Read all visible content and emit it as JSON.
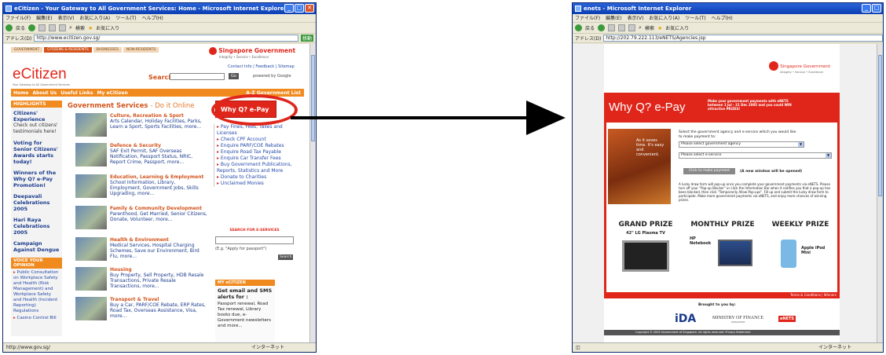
{
  "left": {
    "title": "eCitizen - Your Gateway to All Government Services: Home - Microsoft Internet Explorer",
    "menu": [
      "ファイル(F)",
      "編集(E)",
      "表示(V)",
      "お気に入り(A)",
      "ツール(T)",
      "ヘルプ(H)"
    ],
    "toolbar": [
      "戻る",
      "検索",
      "お気に入り"
    ],
    "address_label": "アドレス(D)",
    "address": "http://www.ecitizen.gov.sg/",
    "go": "移動",
    "top_tabs": [
      "GOVERNMENT",
      "CITIZENS & RESIDENTS",
      "BUSINESSES",
      "NON-RESIDENTS"
    ],
    "gov_brand": "Singapore Government",
    "gov_tag": "Integrity • Service • Excellence",
    "site_name": "eCitizen",
    "site_tag": "Your Gateway to All Government Services",
    "toplinks": "Contact Info | Feedback | Sitemap",
    "search_label": "Search",
    "search_btn": "Go",
    "powered": "powered by Google",
    "nav": [
      "Home",
      "About Us",
      "Useful Links",
      "My eCitizen"
    ],
    "nav_right": "A-Z Government List",
    "highlights_title": "HIGHLIGHTS",
    "highlights": [
      {
        "title": "Citizens' Experience",
        "body": "Check out citizens' testimonials here!"
      },
      {
        "title": "Voting for Senior Citizens' Awards starts today!",
        "body": ""
      },
      {
        "title": "Winners of the Why Q? e-Pay Promotion!",
        "body": ""
      },
      {
        "title": "Deepavali Celebrations 2005",
        "body": ""
      },
      {
        "title": "Hari Raya Celebrations 2005",
        "body": ""
      },
      {
        "title": "Campaign Against Dengue",
        "body": ""
      }
    ],
    "voice_title": "VOICE YOUR OPINION",
    "voice_items": [
      "Public Consultation on Workplace Safety and Health (Risk Management) and Workplace Safety and Health (Incident Reporting) Regulations",
      "Casino Control Bill"
    ],
    "services_title": "Government Services",
    "services_sub": "- Do it Online",
    "categories": [
      {
        "title": "Culture, Recreation & Sport",
        "body": "Arts Calendar, Holiday Facilities, Parks, Learn a Sport, Sports Facilities, more..."
      },
      {
        "title": "Defence & Security",
        "body": "SAF Exit Permit, SAF Overseas Notification, Passport Status, NRIC, Report Crime, Passport, more..."
      },
      {
        "title": "Education, Learning & Employment",
        "body": "School Information, Library, Employment, Government Jobs, Skills Upgrading, more..."
      },
      {
        "title": "Family & Community Development",
        "body": "Parenthood, Get Married, Senior Citizens, Donate, Volunteer, more..."
      },
      {
        "title": "Health & Environment",
        "body": "Medical Services, Hospital Charging Schemes, Save our Environment, Bird Flu, more..."
      },
      {
        "title": "Housing",
        "body": "Buy Property, Sell Property, HDB Resale Transactions, Private Resale Transactions, more..."
      },
      {
        "title": "Transport & Travel",
        "body": "Buy a Car, PARF/COE Rebate, ERP Rates, Road Tax, Overseas Assistance, Visa, more..."
      }
    ],
    "banner": "Why Q? e-Pay",
    "quick_links": [
      "Pay Fines, Fees, Taxes and Licenses",
      "Check CPF Account",
      "Enquire PARF/COE Rebates",
      "Enquire Road Tax Payable",
      "Enquire Car Transfer Fees",
      "Buy Government Publications, Reports, Statistics and More",
      "Donate to Charities",
      "Unclaimed Monies"
    ],
    "eservices_title": "SEARCH FOR E-SERVICES",
    "eservices_hint": "(E.g. \"Apply for passport\")",
    "eservices_btn": "Search",
    "my_title": "MY eCITIZEN",
    "my_head": "Get email and SMS alerts for :",
    "my_body": "Passport renewal, Road Tax renewal, Library books due, e-Government newsletters and more...",
    "status": "http://www.gov.sg/",
    "zone": "インターネット"
  },
  "right": {
    "title": "enets - Microsoft Internet Explorer",
    "menu": [
      "ファイル(F)",
      "編集(E)",
      "表示(V)",
      "お気に入り(A)",
      "ツール(T)",
      "ヘルプ(H)"
    ],
    "toolbar": [
      "戻る",
      "検索",
      "お気に入り"
    ],
    "address_label": "アドレス(D)",
    "address": "http://202.79.222.113/eNETS/Agencies.jsp",
    "gov_brand": "Singapore Government",
    "gov_tag": "Integrity • Service • Excellence",
    "headline": "Why Q? e-Pay",
    "promo": "Make your government payments with eNETS between 1 Jul - 31 Dec 2005 and you could WIN attractive PRIZES!",
    "photo_caption": "As it saves time. It's easy and convenient.",
    "instructions": "Select the government agency and e-service which you would like to make payment to:",
    "agency_select": "Please select government agency",
    "service_select": "Please select e-service",
    "pay_btn": "Click to make payment",
    "new_window": "(A new window will be opened)",
    "draw_text": "A lucky draw form will pop-up once you complete your government payments via eNETS. Please turn off your \"Pop-up Blocker\" or click the Information Bar when it notifies you that a pop-up has been blocked, then click \"Temporarily Allow Pop-ups\". Fill up and submit the lucky draw form to participate. Make more government payments via eNETS, and enjoy more chances of winning prizes.",
    "prizes": [
      {
        "label": "GRAND PRIZE",
        "item": "42\" LG Plasma TV"
      },
      {
        "label": "MONTHLY PRIZE",
        "item": "HP Notebook"
      },
      {
        "label": "WEEKLY PRIZE",
        "item": "Apple iPod Mini"
      }
    ],
    "terms": "Terms & Conditions | Winners",
    "brought": "Brought to you by:",
    "sponsor_ida": "iDA",
    "sponsor_mof": "MINISTRY OF FINANCE",
    "sponsor_mof_sub": "SINGAPORE",
    "sponsor_nets": "eNETS",
    "copyright": "Copyright © 2005 Government of Singapore. All rights reserved. Privacy Statement",
    "zone": "インターネット"
  },
  "colors": {
    "accent_red": "#e0261b",
    "nav_orange": "#f08a1e",
    "link_blue": "#1a3b8c",
    "xp_blue": "#0b3fb3",
    "arrow": "#000000"
  }
}
